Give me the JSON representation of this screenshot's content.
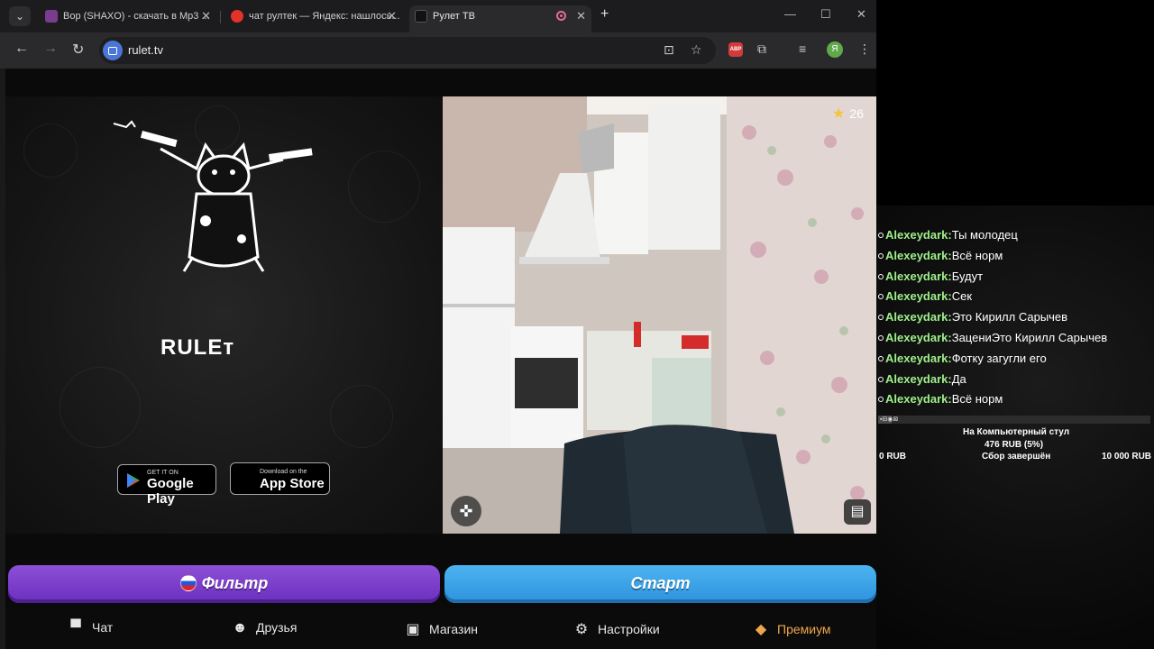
{
  "browser": {
    "tabs": [
      {
        "title": "Вор (SHAXO) - скачать в Mp3 ...",
        "favicon_color": "#7b3b8e"
      },
      {
        "title": "чат рултек — Яндекс: нашлось...",
        "favicon_color": "#e4322b"
      },
      {
        "title": "Рулет ТВ",
        "favicon_color": "#111111"
      }
    ],
    "url": "rulet.tv",
    "profile_initial": "Я",
    "abp_label": "ABP"
  },
  "site": {
    "logo_text": "RULE⁠ᴛ",
    "google_play": {
      "small": "GET IT ON",
      "big": "Google Play"
    },
    "app_store": {
      "small": "Download on the",
      "big": "App Store"
    },
    "rating": "26",
    "filter_label": "Фильтр",
    "start_label": "Старт",
    "nav": [
      {
        "label": "Чат",
        "icon": "chat-icon"
      },
      {
        "label": "Друзья",
        "icon": "friends-icon"
      },
      {
        "label": "Магазин",
        "icon": "shop-bag-icon"
      },
      {
        "label": "Настройки",
        "icon": "gear-icon"
      },
      {
        "label": "Премиум",
        "icon": "price-tag-icon"
      }
    ],
    "colors": {
      "filter": "#7a3ccc",
      "start": "#3aa3e8",
      "premium": "#f0a64e"
    }
  },
  "overlay": {
    "chat": [
      {
        "user": "Alexeydark:",
        "msg": "Ты молодец"
      },
      {
        "user": "Alexeydark:",
        "msg": "Всё норм"
      },
      {
        "user": "Alexeydark:",
        "msg": "Будут"
      },
      {
        "user": "Alexeydark:",
        "msg": "Сек"
      },
      {
        "user": "Alexeydark:",
        "msg": "Это Кирилл Сарычев"
      },
      {
        "user": "Alexeydark:",
        "msg": "ЗацениЭто Кирилл Сарычев"
      },
      {
        "user": "Alexeydark:",
        "msg": "Фотку загугли его"
      },
      {
        "user": "Alexeydark:",
        "msg": "Да"
      },
      {
        "user": "Alexeydark:",
        "msg": "Всё норм"
      }
    ],
    "goal": {
      "title": "На Компьютерный стул",
      "amount": "476 RUB (5%)",
      "min": "0 RUB",
      "status": "Сбор завершён",
      "max": "10 000 RUB",
      "progress": 0.05
    }
  }
}
